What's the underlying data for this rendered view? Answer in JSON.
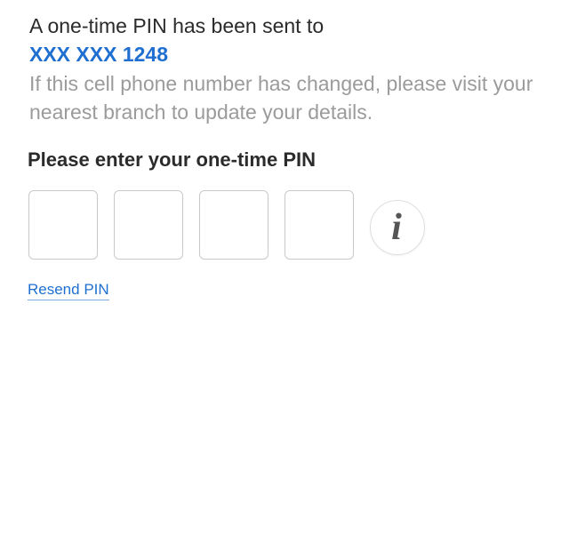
{
  "otp": {
    "sent_text": "A one-time PIN has been sent to",
    "masked_phone": "XXX XXX 1248",
    "change_notice": "If this cell phone number has changed, please visit your nearest branch to update your details.",
    "prompt": "Please enter your one-time PIN",
    "pin_digits": [
      "",
      "",
      "",
      ""
    ],
    "info_icon": "info-icon",
    "info_glyph": "i",
    "resend_label": "Resend PIN"
  },
  "colors": {
    "accent": "#1f6fd1",
    "text_primary": "#2b2b2b",
    "text_muted": "#9b9b9b",
    "box_border": "#c9c9c9"
  }
}
